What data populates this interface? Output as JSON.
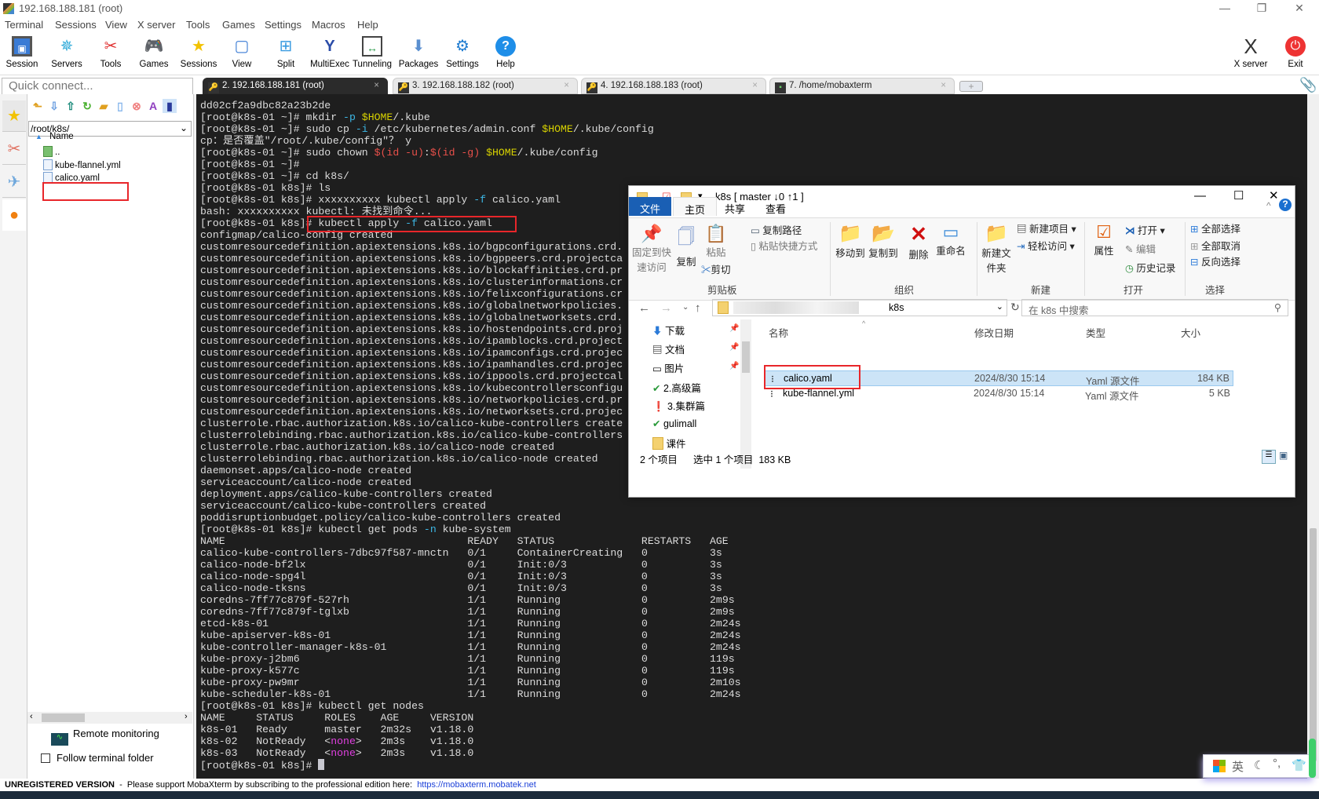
{
  "window": {
    "title": "192.168.188.181 (root)"
  },
  "menu": [
    "Terminal",
    "Sessions",
    "View",
    "X server",
    "Tools",
    "Games",
    "Settings",
    "Macros",
    "Help"
  ],
  "toolbar": [
    {
      "label": "Session",
      "icon": "session-icon"
    },
    {
      "label": "Servers",
      "icon": "servers-icon"
    },
    {
      "label": "Tools",
      "icon": "tools-icon"
    },
    {
      "label": "Games",
      "icon": "games-icon"
    },
    {
      "label": "Sessions",
      "icon": "star-icon"
    },
    {
      "label": "View",
      "icon": "view-icon"
    },
    {
      "label": "Split",
      "icon": "split-icon"
    },
    {
      "label": "MultiExec",
      "icon": "multiexec-icon"
    },
    {
      "label": "Tunneling",
      "icon": "tunneling-icon"
    },
    {
      "label": "Packages",
      "icon": "packages-icon"
    },
    {
      "label": "Settings",
      "icon": "settings-icon"
    },
    {
      "label": "Help",
      "icon": "help-icon"
    }
  ],
  "toolbar_right": [
    {
      "label": "X server",
      "icon": "x-server-icon"
    },
    {
      "label": "Exit",
      "icon": "power-icon"
    }
  ],
  "quick_connect": {
    "placeholder": "Quick connect..."
  },
  "tabs": [
    {
      "label": "2. 192.168.188.181 (root)",
      "active": true
    },
    {
      "label": "3. 192.168.188.182 (root)"
    },
    {
      "label": "4. 192.168.188.183 (root)"
    },
    {
      "label": "7. /home/mobaxterm"
    }
  ],
  "sidebar": {
    "path": "/root/k8s/",
    "column": "Name",
    "files": [
      "..",
      "kube-flannel.yml",
      "calico.yaml"
    ],
    "remote_monitoring": "Remote monitoring",
    "follow_folder": "Follow terminal folder",
    "follow_checked": false
  },
  "colors": {
    "opt": "#3db8e6",
    "var": "#d8d200",
    "sub": "#e8504a",
    "mag": "#e040e0",
    "highlight": "#e8262a"
  },
  "terminal": {
    "lines": [
      "dd02cf2a9dbc82a23b2de",
      [
        {
          "t": "[root@k8s-01 ~]# mkdir "
        },
        {
          "t": "-p",
          "c": "opt"
        },
        {
          "t": " "
        },
        {
          "t": "$HOME",
          "c": "var"
        },
        {
          "t": "/.kube"
        }
      ],
      [
        {
          "t": "[root@k8s-01 ~]# sudo cp "
        },
        {
          "t": "-i",
          "c": "opt"
        },
        {
          "t": " /etc/kubernetes/admin.conf "
        },
        {
          "t": "$HOME",
          "c": "var"
        },
        {
          "t": "/.kube/config"
        }
      ],
      "cp：是否覆盖\"/root/.kube/config\"？ y",
      [
        {
          "t": "[root@k8s-01 ~]# sudo chown "
        },
        {
          "t": "$(id -u)",
          "c": "sub"
        },
        {
          "t": ":"
        },
        {
          "t": "$(id -g)",
          "c": "sub"
        },
        {
          "t": " "
        },
        {
          "t": "$HOME",
          "c": "var"
        },
        {
          "t": "/.kube/config"
        }
      ],
      "[root@k8s-01 ~]#",
      "[root@k8s-01 ~]# cd k8s/",
      "[root@k8s-01 k8s]# ls",
      [
        {
          "t": "[root@k8s-01 k8s]# xxxxxxxxxx kubectl apply "
        },
        {
          "t": "-f",
          "c": "opt"
        },
        {
          "t": " calico.yaml"
        }
      ],
      "bash: xxxxxxxxxx kubectl: 未找到命令...",
      [
        {
          "t": "[root@k8s-01 k8s]# kubectl apply "
        },
        {
          "t": "-f",
          "c": "opt"
        },
        {
          "t": " calico.yaml"
        }
      ],
      "configmap/calico-config created",
      "customresourcedefinition.apiextensions.k8s.io/bgpconfigurations.crd.",
      "customresourcedefinition.apiextensions.k8s.io/bgppeers.crd.projectca",
      "customresourcedefinition.apiextensions.k8s.io/blockaffinities.crd.pr",
      "customresourcedefinition.apiextensions.k8s.io/clusterinformations.cr",
      "customresourcedefinition.apiextensions.k8s.io/felixconfigurations.cr",
      "customresourcedefinition.apiextensions.k8s.io/globalnetworkpolicies.",
      "customresourcedefinition.apiextensions.k8s.io/globalnetworksets.crd.",
      "customresourcedefinition.apiextensions.k8s.io/hostendpoints.crd.proj",
      "customresourcedefinition.apiextensions.k8s.io/ipamblocks.crd.project",
      "customresourcedefinition.apiextensions.k8s.io/ipamconfigs.crd.projec",
      "customresourcedefinition.apiextensions.k8s.io/ipamhandles.crd.projec",
      "customresourcedefinition.apiextensions.k8s.io/ippools.crd.projectcal",
      "customresourcedefinition.apiextensions.k8s.io/kubecontrollersconfigu",
      "customresourcedefinition.apiextensions.k8s.io/networkpolicies.crd.pr",
      "customresourcedefinition.apiextensions.k8s.io/networksets.crd.projec",
      "clusterrole.rbac.authorization.k8s.io/calico-kube-controllers create",
      "clusterrolebinding.rbac.authorization.k8s.io/calico-kube-controllers",
      "clusterrole.rbac.authorization.k8s.io/calico-node created",
      "clusterrolebinding.rbac.authorization.k8s.io/calico-node created",
      "daemonset.apps/calico-node created",
      "serviceaccount/calico-node created",
      "deployment.apps/calico-kube-controllers created",
      "serviceaccount/calico-kube-controllers created",
      "poddisruptionbudget.policy/calico-kube-controllers created",
      [
        {
          "t": "[root@k8s-01 k8s]# kubectl get pods "
        },
        {
          "t": "-n",
          "c": "opt"
        },
        {
          "t": " kube-system"
        }
      ]
    ],
    "pods": {
      "header": [
        "NAME",
        "READY",
        "STATUS",
        "RESTARTS",
        "AGE"
      ],
      "rows": [
        [
          "calico-kube-controllers-7dbc97f587-mnctn",
          "0/1",
          "ContainerCreating",
          "0",
          "3s"
        ],
        [
          "calico-node-bf2lx",
          "0/1",
          "Init:0/3",
          "0",
          "3s"
        ],
        [
          "calico-node-spg4l",
          "0/1",
          "Init:0/3",
          "0",
          "3s"
        ],
        [
          "calico-node-tksns",
          "0/1",
          "Init:0/3",
          "0",
          "3s"
        ],
        [
          "coredns-7ff77c879f-527rh",
          "1/1",
          "Running",
          "0",
          "2m9s"
        ],
        [
          "coredns-7ff77c879f-tglxb",
          "1/1",
          "Running",
          "0",
          "2m9s"
        ],
        [
          "etcd-k8s-01",
          "1/1",
          "Running",
          "0",
          "2m24s"
        ],
        [
          "kube-apiserver-k8s-01",
          "1/1",
          "Running",
          "0",
          "2m24s"
        ],
        [
          "kube-controller-manager-k8s-01",
          "1/1",
          "Running",
          "0",
          "2m24s"
        ],
        [
          "kube-proxy-j2bm6",
          "1/1",
          "Running",
          "0",
          "119s"
        ],
        [
          "kube-proxy-k577c",
          "1/1",
          "Running",
          "0",
          "119s"
        ],
        [
          "kube-proxy-pw9mr",
          "1/1",
          "Running",
          "0",
          "2m10s"
        ],
        [
          "kube-scheduler-k8s-01",
          "1/1",
          "Running",
          "0",
          "2m24s"
        ]
      ]
    },
    "nodes_cmd": "[root@k8s-01 k8s]# kubectl get nodes",
    "nodes": {
      "header": [
        "NAME",
        "STATUS",
        "ROLES",
        "AGE",
        "VERSION"
      ],
      "rows": [
        [
          "k8s-01",
          "Ready",
          "master",
          "2m32s",
          "v1.18.0"
        ],
        [
          "k8s-02",
          "NotReady",
          "<none>",
          "2m3s",
          "v1.18.0"
        ],
        [
          "k8s-03",
          "NotReady",
          "<none>",
          "2m3s",
          "v1.18.0"
        ]
      ]
    },
    "final_prompt": "[root@k8s-01 k8s]# "
  },
  "status": {
    "unregistered": "UNREGISTERED VERSION",
    "message": "  -  Please support MobaXterm by subscribing to the professional edition here:  ",
    "link": "https://mobaxterm.mobatek.net"
  },
  "ime": {
    "lang": "英"
  },
  "explorer": {
    "title": "k8s [ master ↓0 ↑1 ]",
    "ribbon_tabs": [
      "文件",
      "主页",
      "共享",
      "查看"
    ],
    "clipboard": {
      "pin": "固定到快速访问",
      "copy": "复制",
      "paste": "粘贴",
      "copy_path": "复制路径",
      "paste_shortcut": "粘贴快捷方式",
      "cut": "剪切",
      "group": "剪贴板"
    },
    "organize": {
      "move": "移动到",
      "copyto": "复制到",
      "delete": "删除",
      "rename": "重命名",
      "group": "组织"
    },
    "new": {
      "folder": "新建文件夹",
      "item": "新建项目",
      "easy": "轻松访问",
      "group": "新建"
    },
    "open": {
      "props": "属性",
      "open": "打开",
      "edit": "编辑",
      "history": "历史记录",
      "group": "打开"
    },
    "select": {
      "all": "全部选择",
      "none": "全部取消",
      "invert": "反向选择",
      "group": "选择"
    },
    "address": "k8s",
    "search_placeholder": "在 k8s 中搜索",
    "nav": [
      "下载",
      "文档",
      "图片",
      "2.高级篇",
      "3.集群篇",
      "gulimall",
      "课件"
    ],
    "columns": [
      "名称",
      "修改日期",
      "类型",
      "大小"
    ],
    "files": [
      {
        "name": "calico.yaml",
        "date": "2024/8/30 15:14",
        "type": "Yaml 源文件",
        "size": "184 KB",
        "selected": true
      },
      {
        "name": "kube-flannel.yml",
        "date": "2024/8/30 15:14",
        "type": "Yaml 源文件",
        "size": "5 KB"
      }
    ],
    "status_count": "2 个项目",
    "status_selected": "选中 1 个项目  183 KB"
  }
}
